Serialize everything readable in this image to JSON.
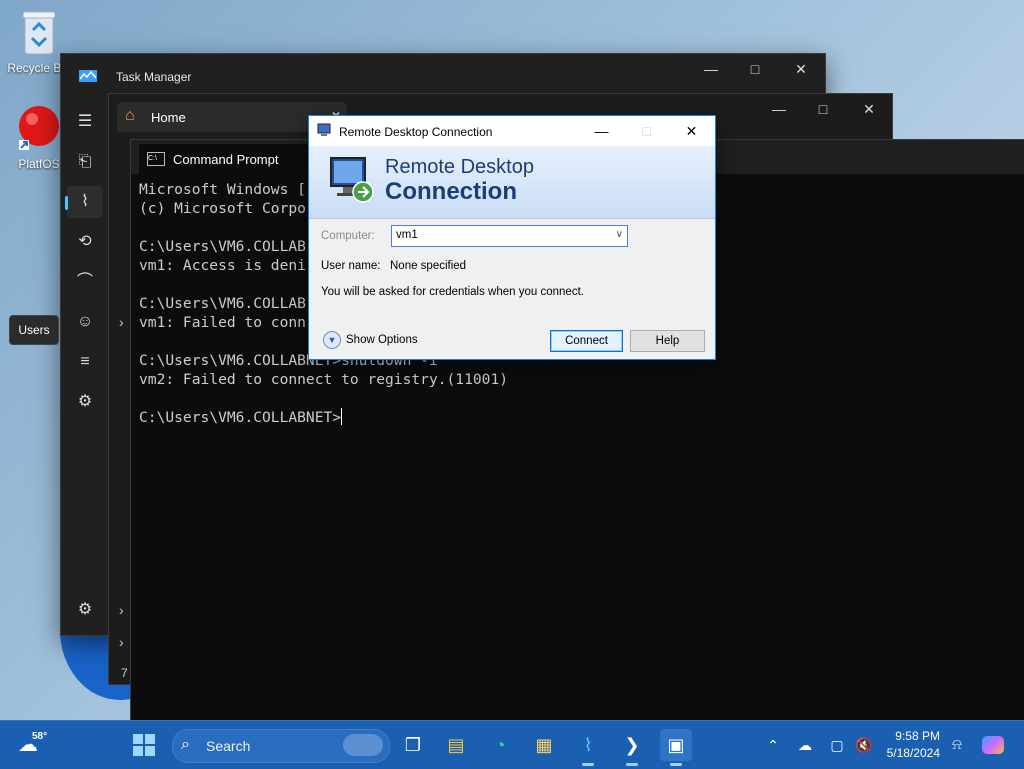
{
  "desktop": {
    "icons": [
      {
        "label": "Recycle Bin"
      },
      {
        "label": "PlatfOS"
      }
    ]
  },
  "task_manager": {
    "title": "Task Manager",
    "nav": [
      "Processes",
      "Performance",
      "App history",
      "Startup apps",
      "Users",
      "Details",
      "Services",
      "Settings"
    ],
    "tooltip": "Users"
  },
  "home_window": {
    "tab_label": "Home",
    "side_items": [
      "›",
      "›",
      "›",
      "7"
    ]
  },
  "command_prompt": {
    "tab_label": "Command Prompt",
    "lines": [
      "Microsoft Windows [",
      "(c) Microsoft Corpo",
      "",
      "C:\\Users\\VM6.COLLAB",
      "vm1: Access is deni",
      "",
      "C:\\Users\\VM6.COLLAB",
      "vm1: Failed to conn",
      "",
      "C:\\Users\\VM6.COLLABNET>shutdown -i",
      "vm2: Failed to connect to registry.(11001)",
      "",
      "C:\\Users\\VM6.COLLABNET>"
    ]
  },
  "rdc": {
    "title": "Remote Desktop Connection",
    "banner_line1": "Remote Desktop",
    "banner_line2": "Connection",
    "computer_label": "Computer:",
    "computer_value": "vm1",
    "username_label": "User name:",
    "username_value": "None specified",
    "info": "You will be asked for credentials when you connect.",
    "show_options": "Show Options",
    "connect": "Connect",
    "help": "Help"
  },
  "taskbar": {
    "weather_temp": "58°",
    "search_placeholder": "Search",
    "time": "9:58 PM",
    "date": "5/18/2024",
    "accent": "#1b5fb0"
  }
}
